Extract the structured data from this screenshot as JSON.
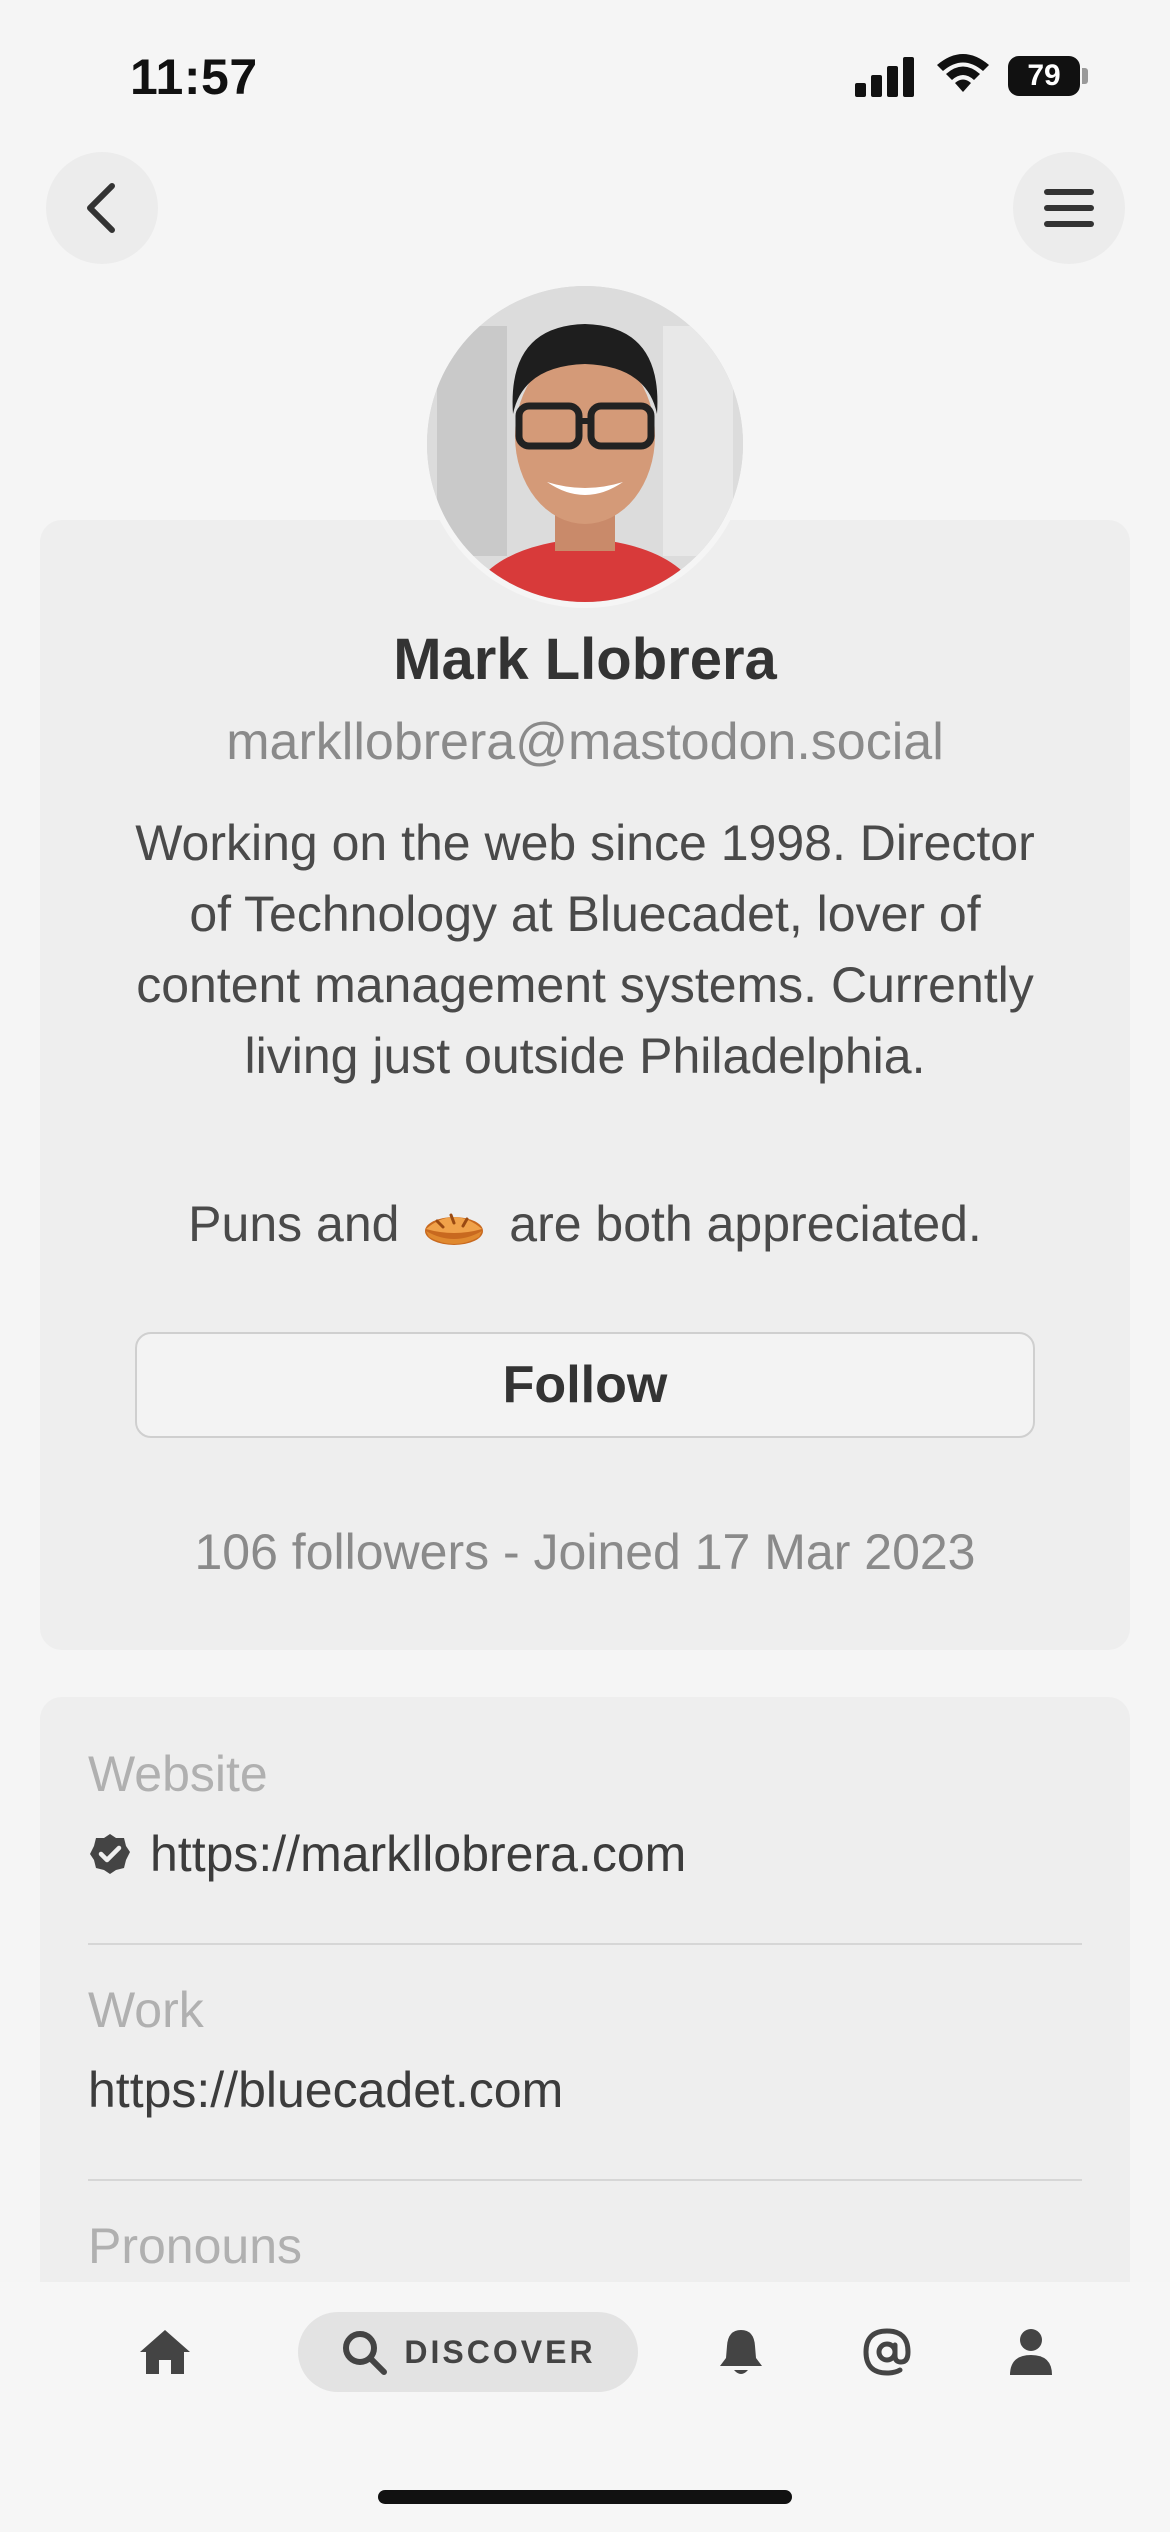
{
  "status_bar": {
    "time": "11:57",
    "battery": "79"
  },
  "profile": {
    "name": "Mark Llobrera",
    "handle": "markllobrera@mastodon.social",
    "bio": "Working on the web since 1998. Director of Technology at Bluecadet, lover of content management systems. Currently living just outside Philadelphia.",
    "bio_line2_before": "Puns and",
    "bio_line2_emoji": "pie-emoji",
    "bio_line2_after": "are both appreciated.",
    "follow_label": "Follow",
    "stats": "106 followers - Joined 17 Mar 2023"
  },
  "fields": [
    {
      "label": "Website",
      "value": "https://markllobrera.com",
      "verified": true
    },
    {
      "label": "Work",
      "value": "https://bluecadet.com",
      "verified": false
    },
    {
      "label": "Pronouns",
      "value": "",
      "verified": false
    }
  ],
  "tab_bar": {
    "discover_label": "DISCOVER",
    "icons": [
      "home-icon",
      "search-icon",
      "bell-icon",
      "at-icon",
      "person-icon"
    ]
  },
  "colors": {
    "background": "#f5f5f5",
    "card": "#eeeeee",
    "muted_text": "#8a8a8a"
  }
}
